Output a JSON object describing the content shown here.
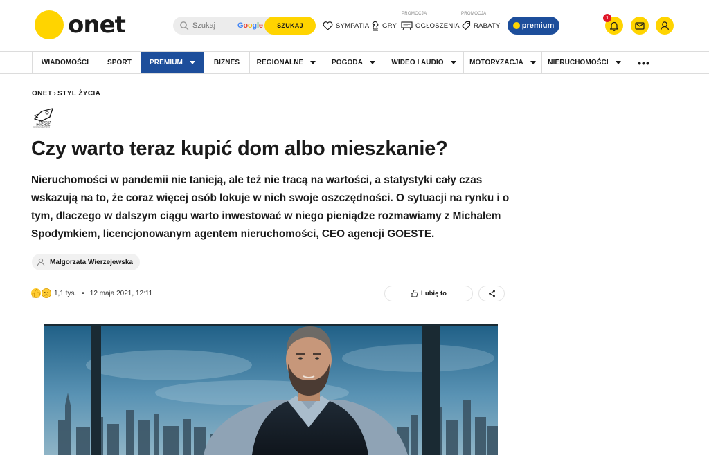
{
  "header": {
    "logo_text": "onet",
    "search": {
      "placeholder": "Szukaj",
      "provider": "Google",
      "button_label": "SZUKAJ"
    },
    "links": [
      {
        "label": "SYMPATIA",
        "icon": "heart-icon"
      },
      {
        "label": "GRY",
        "icon": "chess-knight-icon"
      },
      {
        "label": "OGŁOSZENIA",
        "icon": "classifieds-icon",
        "promo": "PROMOCJA"
      },
      {
        "label": "RABATY",
        "icon": "tag-icon",
        "promo": "PROMOCJA"
      }
    ],
    "premium_label": "premium",
    "notifications_count": "1",
    "colors": {
      "brand_yellow": "#ffd400",
      "premium_blue": "#1d4e9b",
      "badge_red": "#e0172a"
    }
  },
  "nav": {
    "items": [
      {
        "label": "WIADOMOŚCI",
        "has_caret": false
      },
      {
        "label": "SPORT",
        "has_caret": false
      },
      {
        "label": "PREMIUM",
        "has_caret": true,
        "active": true
      },
      {
        "label": "BIZNES",
        "has_caret": false
      },
      {
        "label": "REGIONALNE",
        "has_caret": true
      },
      {
        "label": "POGODA",
        "has_caret": true
      },
      {
        "label": "WIDEO I AUDIO",
        "has_caret": true
      },
      {
        "label": "MOTORYZACJA",
        "has_caret": true
      },
      {
        "label": "NIERUCHOMOŚCI",
        "has_caret": true
      }
    ],
    "more_label": "•••"
  },
  "article": {
    "breadcrumb": [
      "ONET",
      "STYL ŻYCIA"
    ],
    "breadcrumb_separator": "›",
    "partner_logo_text": "ROCKET SCIENCE COMMUNICATIONS",
    "title": "Czy warto teraz kupić dom albo mieszkanie?",
    "lead": "Nieruchomości w pandemii nie tanieją, ale też nie tracą na wartości, a statystyki cały czas wskazują na to, że coraz więcej osób lokuje w nich swoje oszczędności. O sytuacji na rynku i o tym, dlaczego w dalszym ciągu warto inwestować w niego pieniądze rozmawiamy z Michałem Spodymkiem, licencjonowanym agentem nieruchomości, CEO agencji GOESTE.",
    "author": "Małgorzata Wierzejewska",
    "reactions_count": "1,1 tys.",
    "date": "12 maja 2021, 12:11",
    "like_label": "Lubię to"
  }
}
